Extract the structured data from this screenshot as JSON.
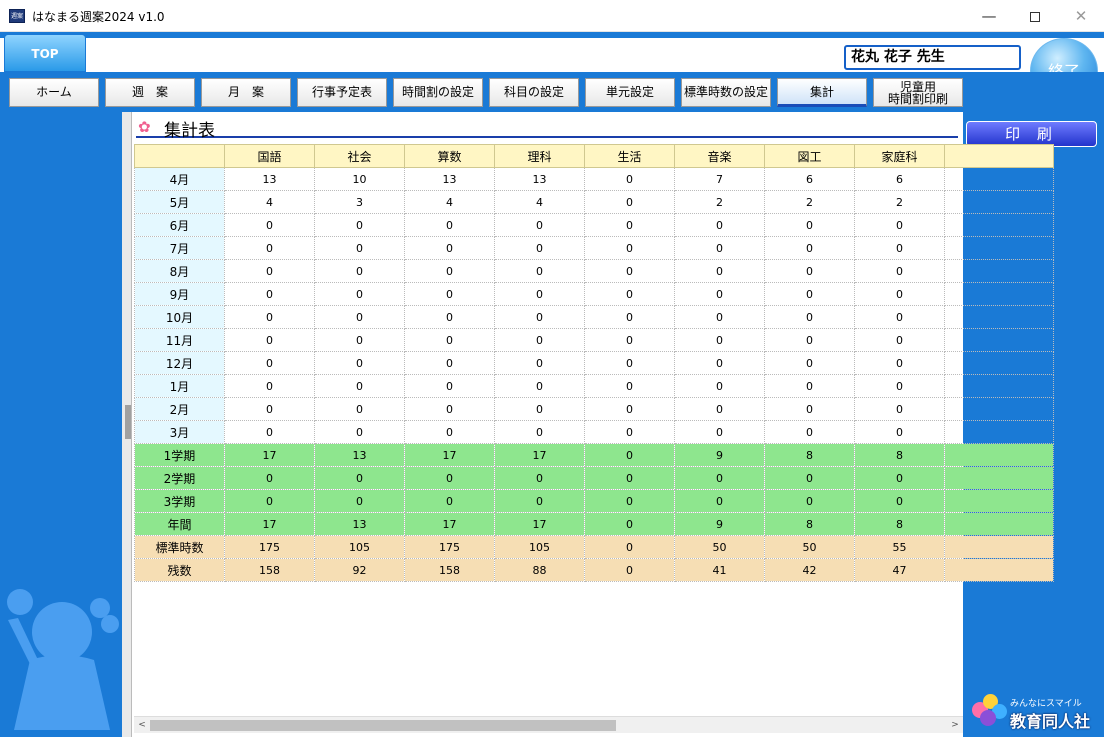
{
  "window": {
    "title": "はなまる週案2024 v1.0",
    "app_icon_text": "週案",
    "minimize_glyph": "—",
    "close_glyph": "✕"
  },
  "header": {
    "top_tab": "TOP",
    "teacher_name": "花丸 花子 先生",
    "exit_label": "終了"
  },
  "nav": {
    "items": [
      {
        "label": "ホーム"
      },
      {
        "label": "週　案"
      },
      {
        "label": "月　案"
      },
      {
        "label": "行事予定表"
      },
      {
        "label": "時間割の設定"
      },
      {
        "label": "科目の設定"
      },
      {
        "label": "単元設定"
      },
      {
        "label": "標準時数の設定"
      },
      {
        "label": "集計"
      },
      {
        "label_line1": "児童用",
        "label_line2": "時間割印刷"
      }
    ],
    "active_index": 8
  },
  "side": {
    "print_label": "印 刷",
    "company_tag": "みんなにスマイル",
    "company_name": "教育同人社"
  },
  "section": {
    "title": "集計表"
  },
  "table": {
    "columns": [
      "国語",
      "社会",
      "算数",
      "理科",
      "生活",
      "音楽",
      "図工",
      "家庭科"
    ],
    "rows": [
      {
        "label": "4月",
        "values": [
          "13",
          "10",
          "13",
          "13",
          "0",
          "7",
          "6",
          "6"
        ],
        "kind": "month"
      },
      {
        "label": "5月",
        "values": [
          "4",
          "3",
          "4",
          "4",
          "0",
          "2",
          "2",
          "2"
        ],
        "kind": "month"
      },
      {
        "label": "6月",
        "values": [
          "0",
          "0",
          "0",
          "0",
          "0",
          "0",
          "0",
          "0"
        ],
        "kind": "month"
      },
      {
        "label": "7月",
        "values": [
          "0",
          "0",
          "0",
          "0",
          "0",
          "0",
          "0",
          "0"
        ],
        "kind": "month"
      },
      {
        "label": "8月",
        "values": [
          "0",
          "0",
          "0",
          "0",
          "0",
          "0",
          "0",
          "0"
        ],
        "kind": "month"
      },
      {
        "label": "9月",
        "values": [
          "0",
          "0",
          "0",
          "0",
          "0",
          "0",
          "0",
          "0"
        ],
        "kind": "month"
      },
      {
        "label": "10月",
        "values": [
          "0",
          "0",
          "0",
          "0",
          "0",
          "0",
          "0",
          "0"
        ],
        "kind": "month"
      },
      {
        "label": "11月",
        "values": [
          "0",
          "0",
          "0",
          "0",
          "0",
          "0",
          "0",
          "0"
        ],
        "kind": "month"
      },
      {
        "label": "12月",
        "values": [
          "0",
          "0",
          "0",
          "0",
          "0",
          "0",
          "0",
          "0"
        ],
        "kind": "month"
      },
      {
        "label": "1月",
        "values": [
          "0",
          "0",
          "0",
          "0",
          "0",
          "0",
          "0",
          "0"
        ],
        "kind": "month"
      },
      {
        "label": "2月",
        "values": [
          "0",
          "0",
          "0",
          "0",
          "0",
          "0",
          "0",
          "0"
        ],
        "kind": "month"
      },
      {
        "label": "3月",
        "values": [
          "0",
          "0",
          "0",
          "0",
          "0",
          "0",
          "0",
          "0"
        ],
        "kind": "month"
      },
      {
        "label": "1学期",
        "values": [
          "17",
          "13",
          "17",
          "17",
          "0",
          "9",
          "8",
          "8"
        ],
        "kind": "term"
      },
      {
        "label": "2学期",
        "values": [
          "0",
          "0",
          "0",
          "0",
          "0",
          "0",
          "0",
          "0"
        ],
        "kind": "term"
      },
      {
        "label": "3学期",
        "values": [
          "0",
          "0",
          "0",
          "0",
          "0",
          "0",
          "0",
          "0"
        ],
        "kind": "term"
      },
      {
        "label": "年間",
        "values": [
          "17",
          "13",
          "17",
          "17",
          "0",
          "9",
          "8",
          "8"
        ],
        "kind": "term"
      },
      {
        "label": "標準時数",
        "values": [
          "175",
          "105",
          "175",
          "105",
          "0",
          "50",
          "50",
          "55"
        ],
        "kind": "std"
      },
      {
        "label": "残数",
        "values": [
          "158",
          "92",
          "158",
          "88",
          "0",
          "41",
          "42",
          "47"
        ],
        "kind": "std"
      }
    ]
  },
  "scroll": {
    "left_arrow": "<",
    "right_arrow": ">"
  },
  "colors": {
    "brand_blue": "#1a7ad6",
    "term_green": "#8ee68e",
    "std_tan": "#f6deb4",
    "header_yellow": "#fff6c4",
    "month_cyan": "#e4f8ff"
  }
}
